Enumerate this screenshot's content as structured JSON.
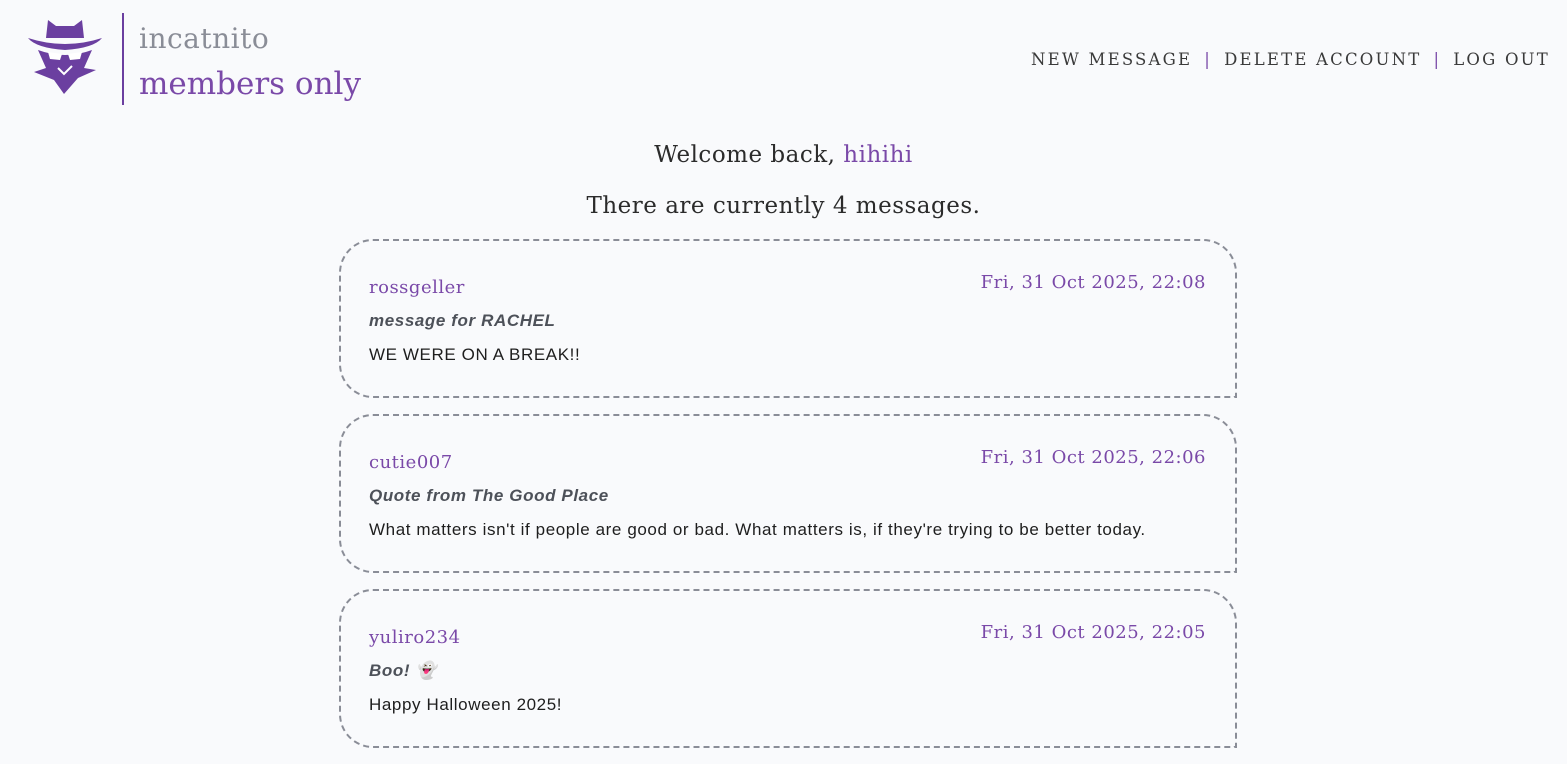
{
  "brand": {
    "name": "incatnito",
    "tagline": "members only",
    "logo_icon": "incognito-cat-icon",
    "accent_color": "#7a49a8"
  },
  "nav": {
    "items": [
      "NEW MESSAGE",
      "DELETE ACCOUNT",
      "LOG OUT"
    ],
    "separator": "|"
  },
  "welcome": {
    "prefix": "Welcome back, ",
    "username": "hihihi"
  },
  "message_count_text": "There are currently 4 messages.",
  "messages": [
    {
      "author": "rossgeller",
      "date": "Fri, 31 Oct 2025, 22:08",
      "title": "message for RACHEL",
      "body": "WE WERE ON A BREAK!!"
    },
    {
      "author": "cutie007",
      "date": "Fri, 31 Oct 2025, 22:06",
      "title": "Quote from The Good Place",
      "body": "What matters isn't if people are good or bad. What matters is, if they're trying to be better today."
    },
    {
      "author": "yuliro234",
      "date": "Fri, 31 Oct 2025, 22:05",
      "title": "Boo! 👻",
      "body": "Happy Halloween 2025!"
    }
  ]
}
